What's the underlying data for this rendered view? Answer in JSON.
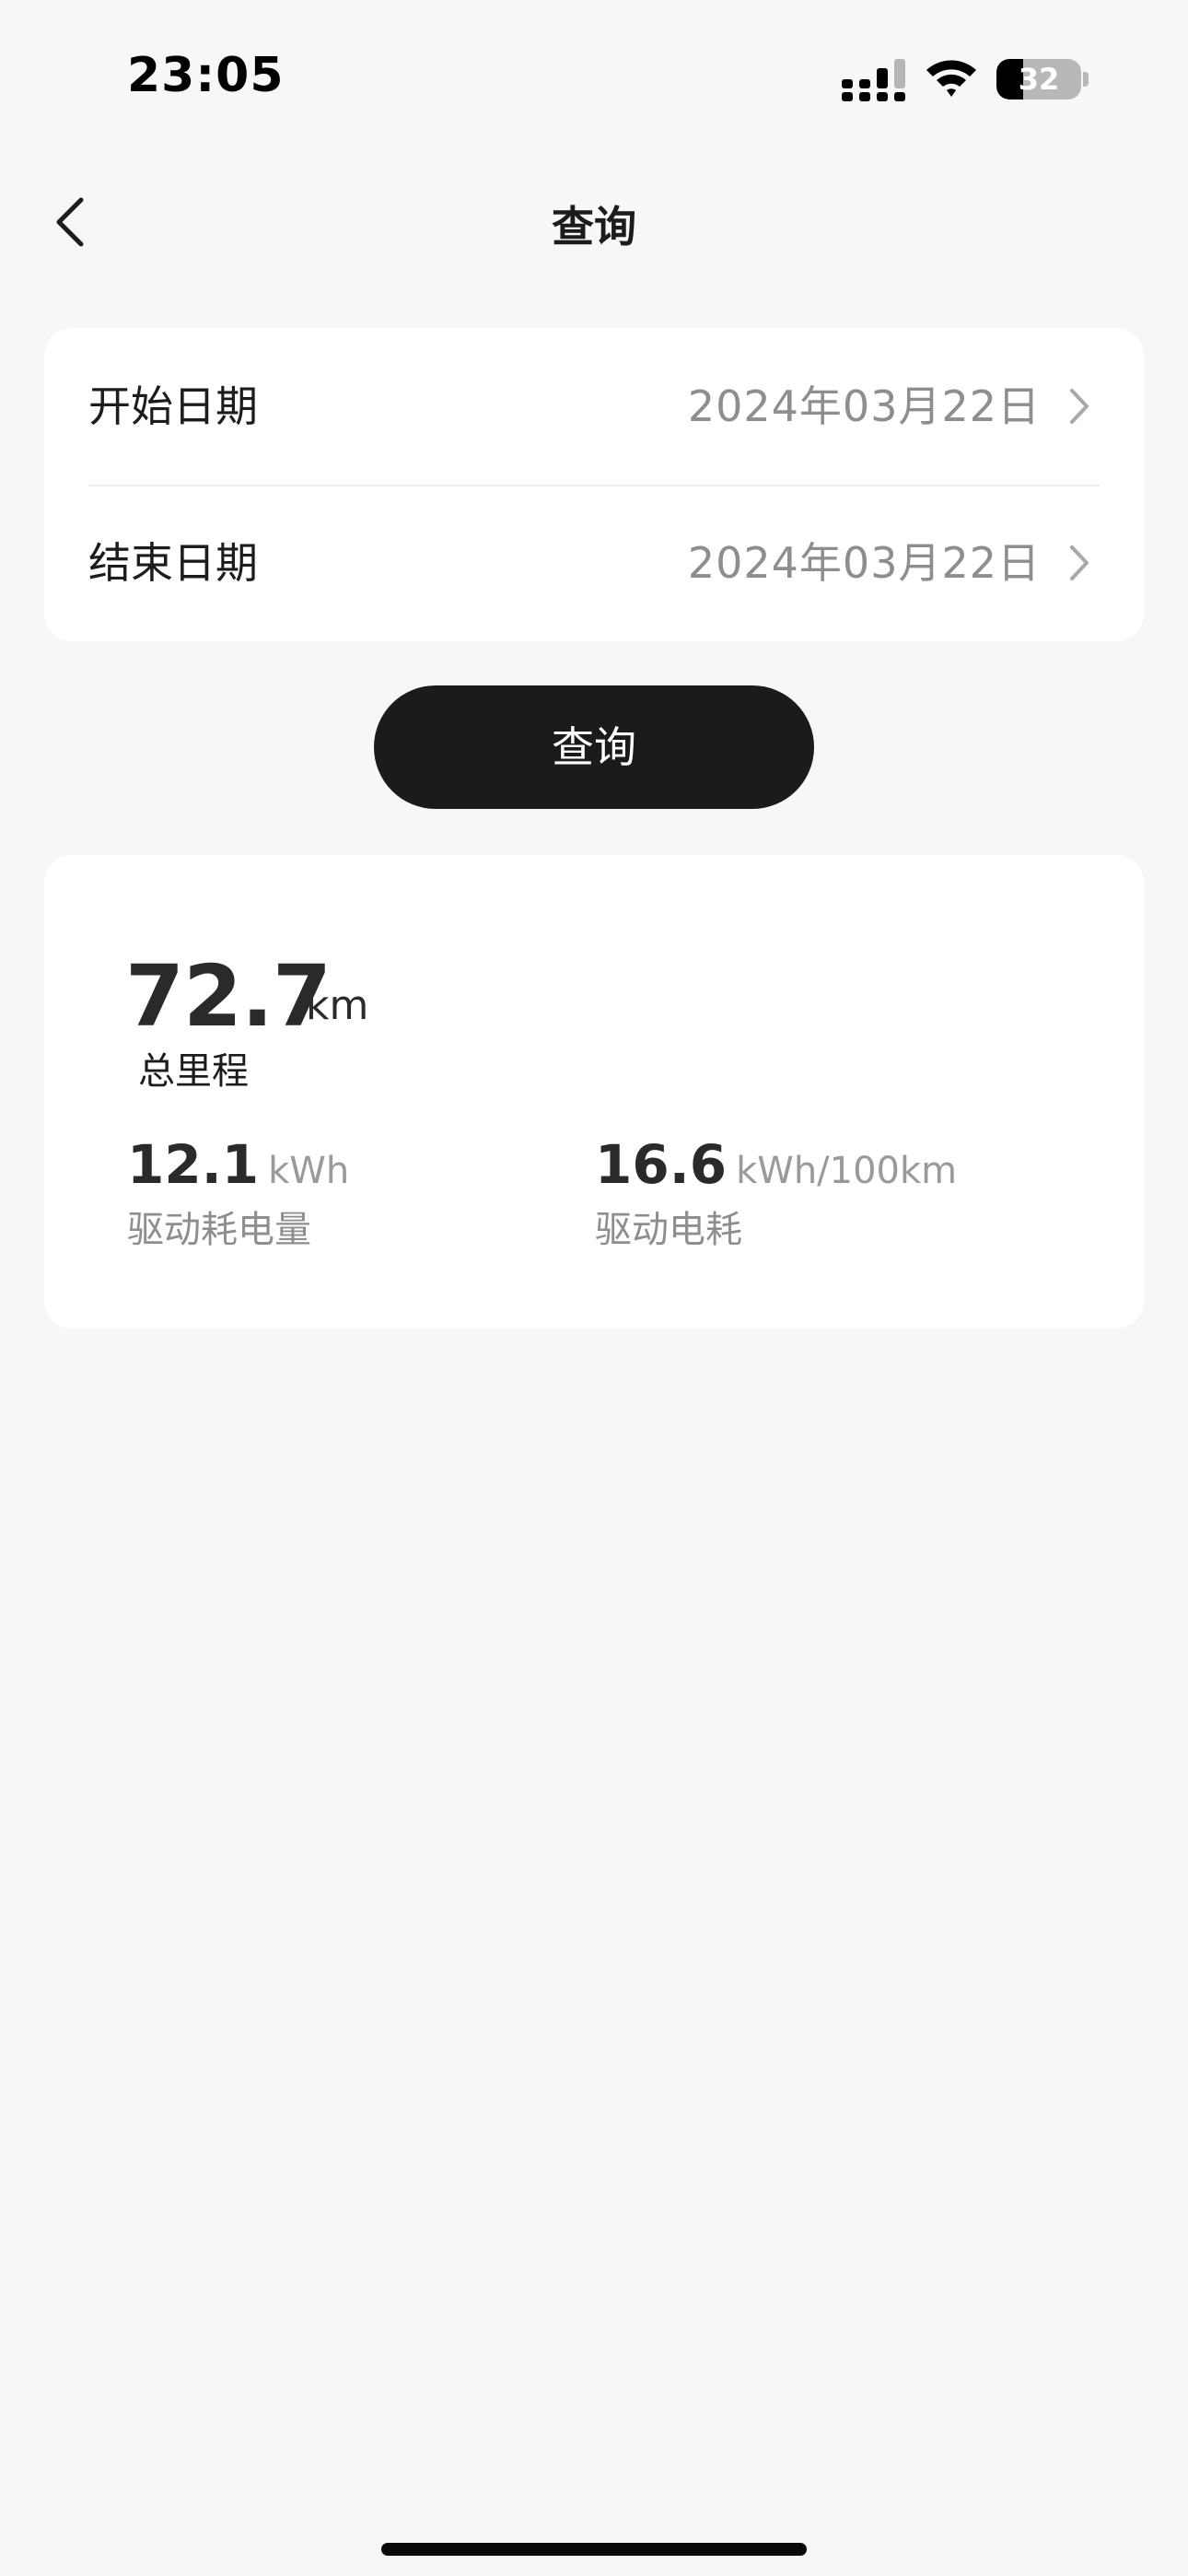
{
  "status_bar": {
    "time": "23:05",
    "battery_level": "32",
    "battery_fraction": 0.32
  },
  "nav": {
    "title": "查询",
    "back_icon": "chevron-left-icon"
  },
  "date_filter": {
    "start": {
      "label": "开始日期",
      "value": "2024年03月22日"
    },
    "end": {
      "label": "结束日期",
      "value": "2024年03月22日"
    },
    "row_icon": "chevron-right-icon"
  },
  "query_button": {
    "label": "查询"
  },
  "results": {
    "total_mileage": {
      "value": "72.7",
      "unit": "km",
      "label": "总里程"
    },
    "drive_energy": {
      "value": "12.1",
      "unit": "kWh",
      "label": "驱动耗电量"
    },
    "drive_consumption": {
      "value": "16.6",
      "unit": "kWh/100km",
      "label": "驱动电耗"
    }
  },
  "colors": {
    "background": "#f7f7f7",
    "card": "#ffffff",
    "button": "#1b1b1b",
    "primary_text": "#1c1c1c",
    "secondary_text": "#8e8e8e"
  }
}
